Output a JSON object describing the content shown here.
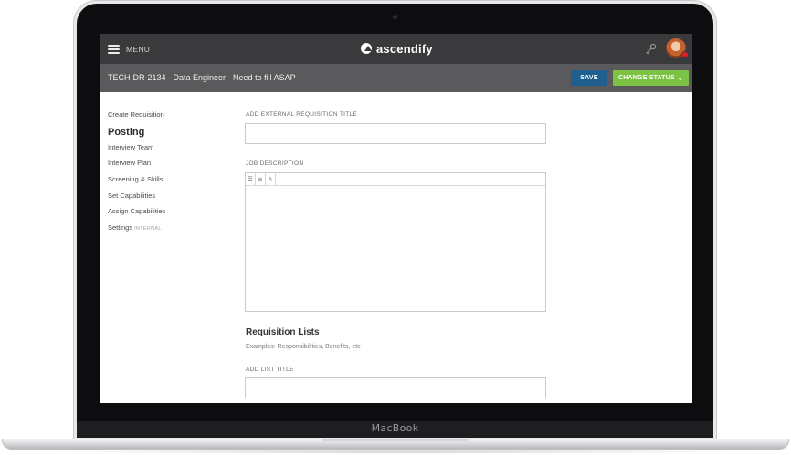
{
  "device": {
    "brand": "MacBook"
  },
  "topbar": {
    "menu_label": "MENU",
    "logo_text": "ascendify"
  },
  "subbar": {
    "requisition_title": "TECH-DR-2134 - Data Engineer - Need to fill ASAP",
    "save_label": "SAVE",
    "change_status_label": "CHANGE STATUS",
    "colors": {
      "save": "#1f5f8f",
      "change_status": "#7cc243"
    }
  },
  "sidebar": {
    "items": [
      {
        "label": "Create Requisition"
      },
      {
        "label": "Posting",
        "active": true
      },
      {
        "label": "Interview Team"
      },
      {
        "label": "Interview Plan"
      },
      {
        "label": "Screening & Skills"
      },
      {
        "label": "Set Capabilities"
      },
      {
        "label": "Assign Capabilities"
      },
      {
        "label": "Settings",
        "tag": "INTERNAL"
      }
    ]
  },
  "form": {
    "external_title_label": "ADD EXTERNAL REQUISITION TITLE",
    "external_title_value": "",
    "job_description_label": "JOB DESCRIPTION",
    "job_description_value": "",
    "toolbar_icons": [
      "bulleted-list-icon",
      "numbered-list-icon",
      "link-icon"
    ],
    "requisition_lists_heading": "Requisition Lists",
    "requisition_lists_sub": "Examples: Responsibilities, Benefits, etc",
    "list_title_label": "ADD LIST TITLE",
    "list_title_value": ""
  }
}
